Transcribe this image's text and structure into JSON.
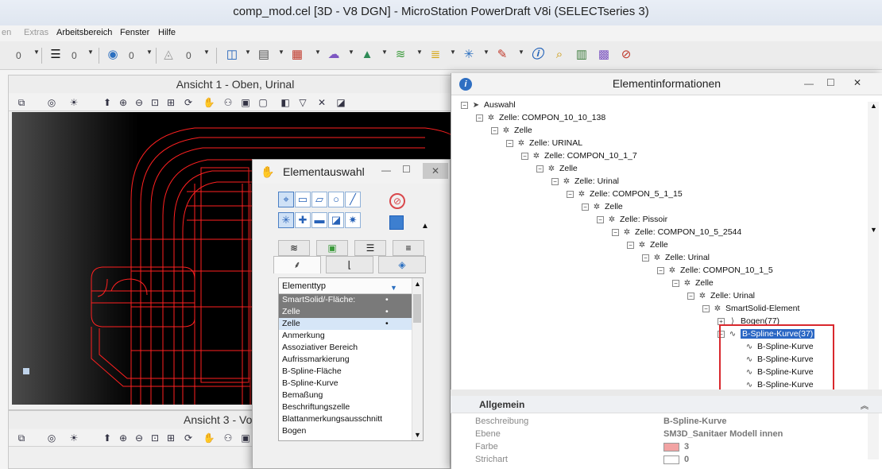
{
  "window_title": "comp_mod.cel [3D - V8 DGN] - MicroStation PowerDraft V8i (SELECTseries 3)",
  "menu": {
    "partial_left": "en",
    "extras": "Extras",
    "arbeitsbereich": "Arbeitsbereich",
    "fenster": "Fenster",
    "hilfe": "Hilfe"
  },
  "toolbar": {
    "value_a": "0",
    "value_b": "0",
    "value_c": "0",
    "value_d": "0"
  },
  "view1": {
    "title": "Ansicht 1 - Oben, Urinal"
  },
  "view3": {
    "title": "Ansicht 3 - Vo"
  },
  "selection_window": {
    "title": "Elementauswahl",
    "list_header": "Elementtyp",
    "items": [
      {
        "label": "SmartSolid/-Fläche:",
        "mark": "•"
      },
      {
        "label": "Zelle",
        "mark": "•"
      },
      {
        "label": "Zelle",
        "mark": "•"
      },
      {
        "label": "Anmerkung",
        "mark": ""
      },
      {
        "label": "Assoziativer Bereich",
        "mark": ""
      },
      {
        "label": "Aufrissmarkierung",
        "mark": ""
      },
      {
        "label": "B-Spline-Fläche",
        "mark": ""
      },
      {
        "label": "B-Spline-Kurve",
        "mark": ""
      },
      {
        "label": "Bemaßung",
        "mark": ""
      },
      {
        "label": "Beschriftungszelle",
        "mark": ""
      },
      {
        "label": "Blattanmerkungsausschnitt",
        "mark": ""
      },
      {
        "label": "Bogen",
        "mark": ""
      }
    ]
  },
  "info_window": {
    "title": "Elementinformationen",
    "tree": [
      {
        "label": "Auswahl",
        "level": 0,
        "icon": "cursor-icon"
      },
      {
        "label": "Zelle: COMPON_10_10_138",
        "level": 1,
        "icon": "cell-icon"
      },
      {
        "label": "Zelle",
        "level": 2,
        "icon": "cell-icon"
      },
      {
        "label": "Zelle: URINAL",
        "level": 3,
        "icon": "cell-icon"
      },
      {
        "label": "Zelle: COMPON_10_1_7",
        "level": 4,
        "icon": "cell-icon"
      },
      {
        "label": "Zelle",
        "level": 5,
        "icon": "cell-icon"
      },
      {
        "label": "Zelle: Urinal",
        "level": 6,
        "icon": "cell-icon"
      },
      {
        "label": "Zelle: COMPON_5_1_15",
        "level": 7,
        "icon": "cell-icon"
      },
      {
        "label": "Zelle",
        "level": 8,
        "icon": "cell-icon"
      },
      {
        "label": "Zelle: Pissoir",
        "level": 9,
        "icon": "cell-icon"
      },
      {
        "label": "Zelle: COMPON_10_5_2544",
        "level": 10,
        "icon": "cell-icon"
      },
      {
        "label": "Zelle",
        "level": 11,
        "icon": "cell-icon"
      },
      {
        "label": "Zelle: Urinal",
        "level": 12,
        "icon": "cell-icon"
      },
      {
        "label": "Zelle: COMPON_10_1_5",
        "level": 13,
        "icon": "cell-icon"
      },
      {
        "label": "Zelle",
        "level": 14,
        "icon": "cell-icon"
      },
      {
        "label": "Zelle: Urinal",
        "level": 15,
        "icon": "cell-icon"
      },
      {
        "label": "SmartSolid-Element",
        "level": 16,
        "icon": "cell-icon"
      },
      {
        "label": "Bogen(77)",
        "level": 17,
        "icon": "arc-icon"
      },
      {
        "label": "B-Spline-Kurve(37)",
        "level": 17,
        "icon": "spline-icon",
        "selected": true
      },
      {
        "label": "B-Spline-Kurve",
        "level": 18,
        "icon": "spline-icon"
      },
      {
        "label": "B-Spline-Kurve",
        "level": 18,
        "icon": "spline-icon"
      },
      {
        "label": "B-Spline-Kurve",
        "level": 18,
        "icon": "spline-icon"
      },
      {
        "label": "B-Spline-Kurve",
        "level": 18,
        "icon": "spline-icon"
      }
    ],
    "section": "Allgemein",
    "properties": [
      {
        "key": "Beschreibung",
        "value": "B-Spline-Kurve"
      },
      {
        "key": "Ebene",
        "value": "SM3D_Sanitaer Modell innen"
      },
      {
        "key": "Farbe",
        "value": "3",
        "swatch": "#f2a3a3"
      },
      {
        "key": "Strichart",
        "value": "0",
        "swatch": "#ffffff"
      }
    ]
  },
  "colors": {
    "wireframe": "#ff2020",
    "highlight_box": "#d9282d",
    "tree_selection": "#2a67c4"
  }
}
